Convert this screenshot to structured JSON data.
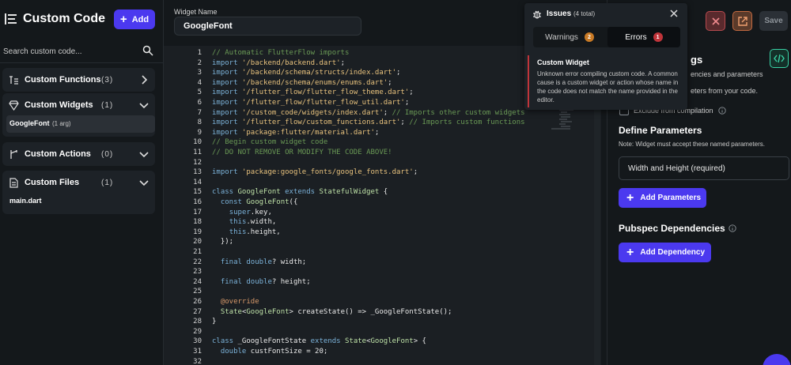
{
  "sidebar": {
    "title": "Custom Code",
    "add_label": "Add",
    "search_placeholder": "Search custom code...",
    "sections": [
      {
        "label": "Custom Functions",
        "count": "(3)"
      },
      {
        "label": "Custom Widgets",
        "count": "(1)",
        "items": [
          {
            "label": "GoogleFont",
            "sub": "(1 arg)"
          }
        ]
      },
      {
        "label": "Custom Actions",
        "count": "(0)"
      },
      {
        "label": "Custom Files",
        "count": "(1)",
        "items": [
          {
            "label": "main.dart"
          }
        ]
      }
    ]
  },
  "editor": {
    "widget_name_label": "Widget Name",
    "widget_name_value": "GoogleFont",
    "line_numbers": [
      "1",
      "2",
      "3",
      "4",
      "5",
      "6",
      "7",
      "8",
      "9",
      "10",
      "11",
      "12",
      "13",
      "14",
      "15",
      "16",
      "17",
      "18",
      "19",
      "20",
      "21",
      "22",
      "23",
      "24",
      "25",
      "26",
      "27",
      "28",
      "29",
      "30",
      "31",
      "32"
    ]
  },
  "issues": {
    "title": "Issues",
    "count": "(4 total)",
    "warnings_label": "Warnings",
    "warnings_count": "2",
    "errors_label": "Errors",
    "errors_count": "1",
    "item_title": "Custom Widget",
    "item_desc": "Unknown error compiling custom code. A common cause is a custom widget or action whose name in the code does not match the name provided in the editor."
  },
  "right_panel": {
    "save_label": "Save",
    "heading_fragment": "gs",
    "desc_fragment_1": "encies and parameters",
    "desc_fragment_2": "eters from your code.",
    "exclude_label": "Exclude from compilation",
    "define_params_title": "Define Parameters",
    "define_params_note": "Note: Widget must accept these named parameters.",
    "param_value": "Width and Height (required)",
    "add_params_label": "Add Parameters",
    "pubspec_title": "Pubspec Dependencies",
    "add_dependency_label": "Add Dependency"
  },
  "colors": {
    "accent": "#4b39ef",
    "error": "#c0343a",
    "warning": "#c97a25",
    "code_toggle": "#39d2a5"
  },
  "icons": [
    "code-list-icon",
    "plus-icon",
    "search-icon",
    "function-icon",
    "widget-diamond-icon",
    "action-branch-icon",
    "file-icon",
    "chevron-right-icon",
    "chevron-down-icon",
    "bug-icon",
    "close-icon",
    "open-external-icon",
    "code-brackets-icon",
    "info-icon"
  ]
}
